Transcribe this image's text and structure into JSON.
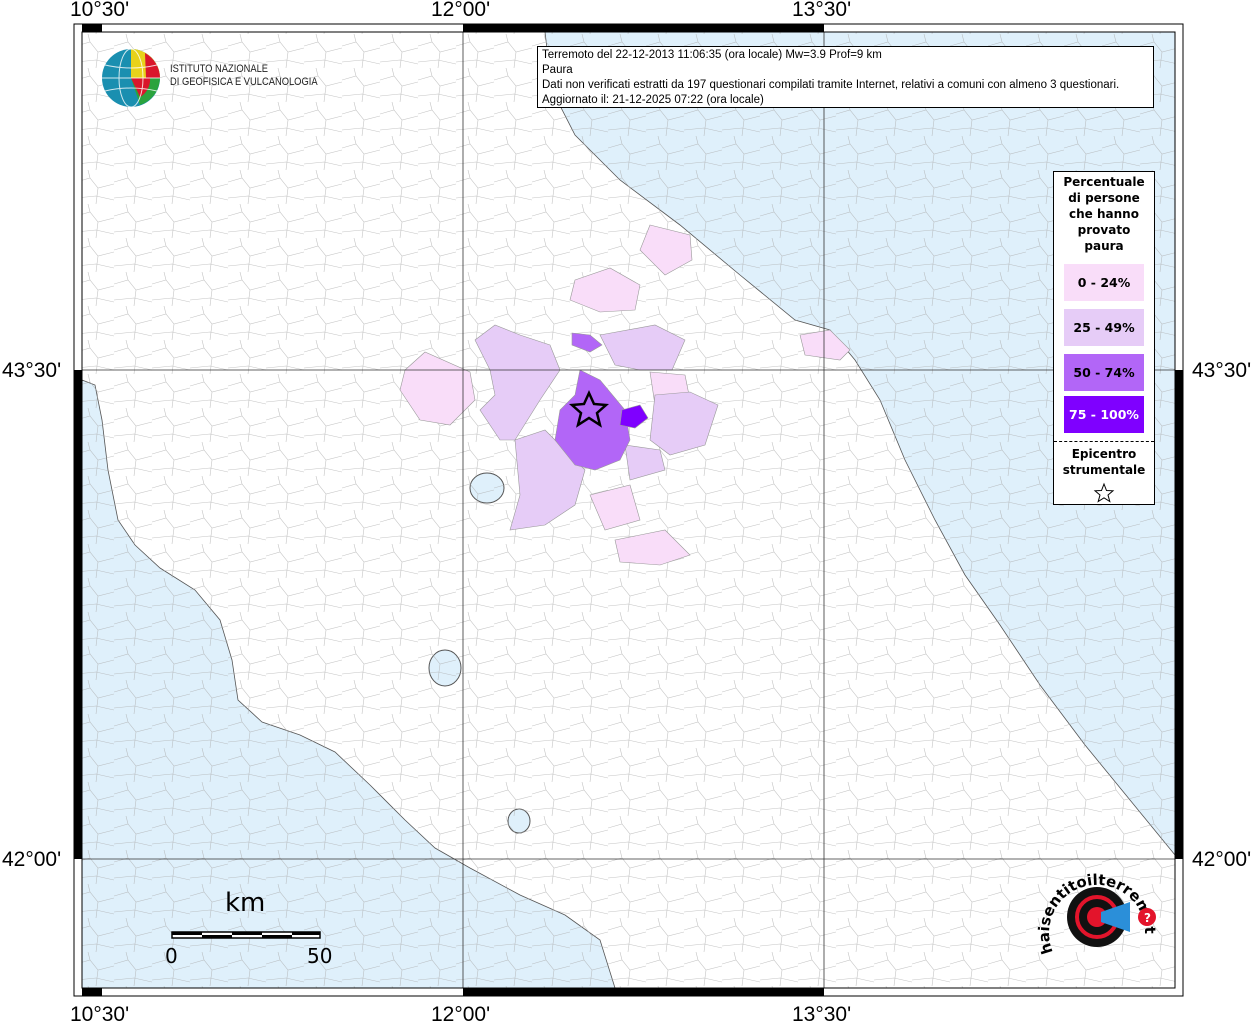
{
  "info": {
    "line1": "Terremoto del 22-12-2013 11:06:35 (ora locale) Mw=3.9 Prof=9 km",
    "line2": "Paura",
    "line3": "Dati non verificati estratti da 197 questionari compilati tramite Internet, relativi a comuni con almeno 3 questionari.",
    "line4": "Aggiornato il: 21-12-2025 07:22 (ora locale)"
  },
  "axes": {
    "lon": [
      "10°30'",
      "12°00'",
      "13°30'"
    ],
    "lat": [
      "43°30'",
      "42°00'"
    ]
  },
  "legend": {
    "title_lines": [
      "Percentuale",
      "di persone",
      "che hanno",
      "provato",
      "paura"
    ],
    "classes": [
      {
        "label": "0 - 24%",
        "color": "#f9ddf9"
      },
      {
        "label": "25 - 49%",
        "color": "#e6ccf7"
      },
      {
        "label": "50 - 74%",
        "color": "#b266f7"
      },
      {
        "label": "75 - 100%",
        "color": "#7f00ff"
      }
    ],
    "epicenter_lines": [
      "Epicentro",
      "strumentale"
    ]
  },
  "logo_ingv": {
    "line1": "ISTITUTO NAZIONALE",
    "line2": "DI GEOFISICA E VULCANOLOGIA"
  },
  "logo_hst": {
    "text": "www.haisentitoilterremoto.it"
  },
  "scale": {
    "unit": "km",
    "min": "0",
    "max": "50"
  },
  "colors": {
    "sea": "#dff0fb",
    "border": "#999999"
  }
}
